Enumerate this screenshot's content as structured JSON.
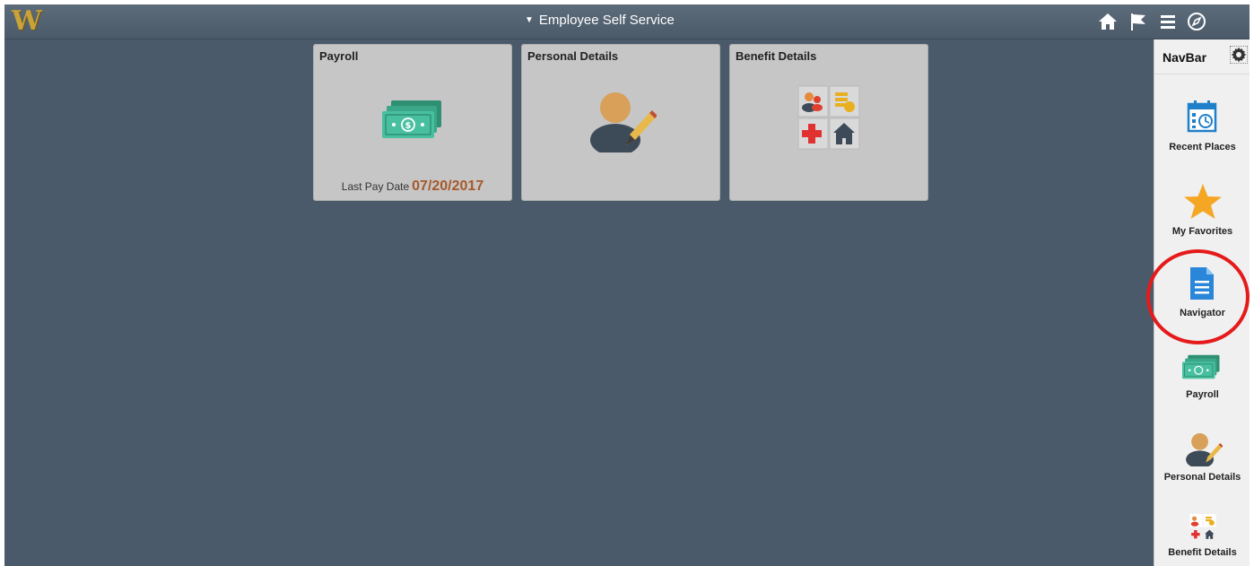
{
  "header": {
    "logo": "W",
    "title": "Employee Self Service",
    "icons": [
      "home-icon",
      "flag-icon",
      "menu-icon",
      "compass-icon"
    ]
  },
  "tiles": [
    {
      "title": "Payroll",
      "icon": "money-icon",
      "footer_label": "Last Pay Date",
      "footer_value": "07/20/2017"
    },
    {
      "title": "Personal Details",
      "icon": "person-edit-icon"
    },
    {
      "title": "Benefit Details",
      "icon": "benefits-grid-icon"
    }
  ],
  "navbar": {
    "title": "NavBar",
    "settings_icon": "gear-icon",
    "items": [
      {
        "label": "Recent Places",
        "icon": "calendar-clock-icon"
      },
      {
        "label": "My Favorites",
        "icon": "star-icon"
      },
      {
        "label": "Navigator",
        "icon": "document-icon",
        "highlighted": true
      },
      {
        "label": "Payroll",
        "icon": "money-icon"
      },
      {
        "label": "Personal Details",
        "icon": "person-edit-icon"
      },
      {
        "label": "Benefit Details",
        "icon": "benefits-grid-icon"
      }
    ]
  },
  "colors": {
    "background": "#4a5a6a",
    "header": "#556574",
    "tile": "#c6c6c6",
    "accent_date": "#a55a2a",
    "logo_gold": "#c9a23a",
    "highlight_circle": "#e51b1b"
  }
}
